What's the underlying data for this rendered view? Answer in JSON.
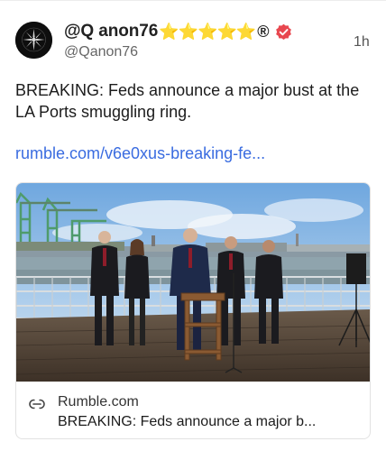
{
  "post": {
    "display_name": "@Q anon76",
    "name_emoji": "⭐⭐⭐⭐⭐",
    "name_registered": "®",
    "handle": "@Qanon76",
    "timestamp": "1h",
    "text": "BREAKING: Feds announce a major bust at the LA Ports smuggling ring.",
    "link_text": "rumble.com/v6e0xus-breaking-fe...",
    "verified_color": "#e8474f",
    "link_color": "#3a6ce0"
  },
  "link_card": {
    "domain": "Rumble.com",
    "title": "BREAKING: Feds announce a major b...",
    "link_icon": "link-icon"
  }
}
